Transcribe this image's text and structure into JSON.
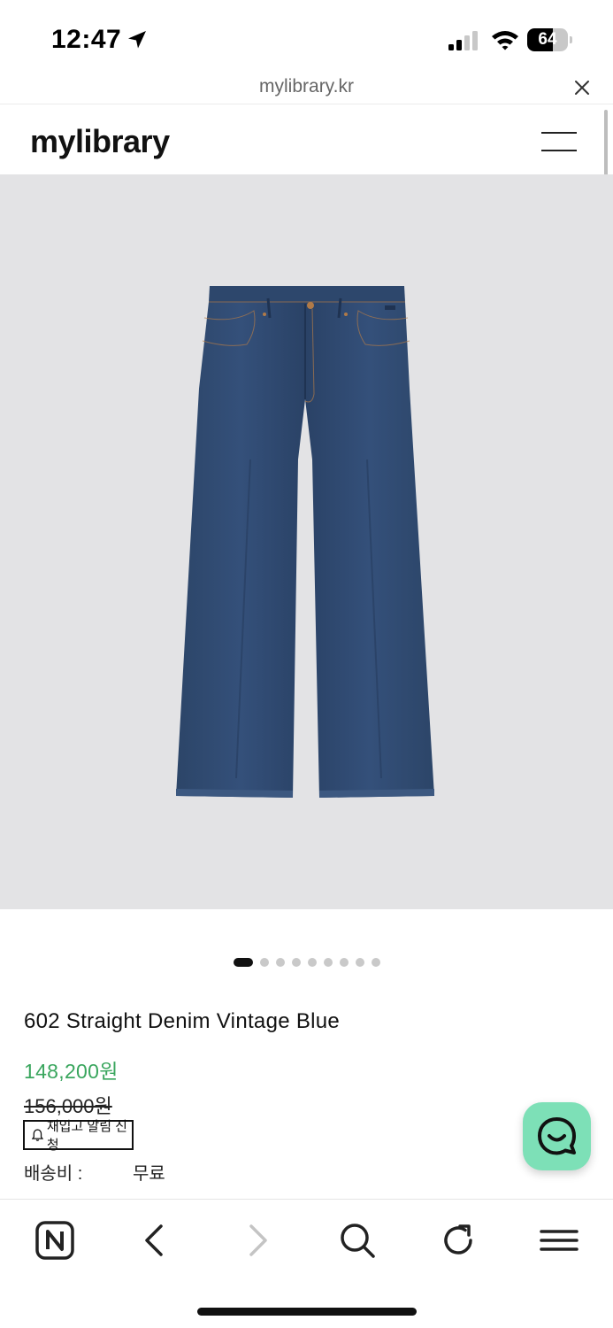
{
  "status_bar": {
    "time": "12:47",
    "battery_level": 64,
    "icons": [
      "location-arrow-icon",
      "cellular-signal-icon",
      "wifi-icon",
      "battery-icon"
    ]
  },
  "browser": {
    "url": "mylibrary.kr",
    "close_icon": "close-icon"
  },
  "header": {
    "logo": "mylibrary",
    "menu_icon": "hamburger-menu-icon"
  },
  "gallery": {
    "slide_count": 9,
    "active_index": 0,
    "image_subject": "straight denim jeans",
    "background_color": "#e3e3e5",
    "denim_color": "#2a4466"
  },
  "product": {
    "name": "602 Straight Denim Vintage Blue",
    "sale_price": "148,200원",
    "original_price": "156,000원",
    "restock_label": "재입고 알림 신청",
    "shipping_label": "배송비 :",
    "shipping_value": "무료",
    "sale_color": "#3aa65e"
  },
  "chat": {
    "icon": "chat-bubble-smile-icon",
    "color": "#7de0b7"
  },
  "toolbar": {
    "items": [
      "naver-home-icon",
      "back-arrow-icon",
      "forward-arrow-icon",
      "search-icon",
      "refresh-icon",
      "menu-icon"
    ],
    "forward_enabled": false
  }
}
